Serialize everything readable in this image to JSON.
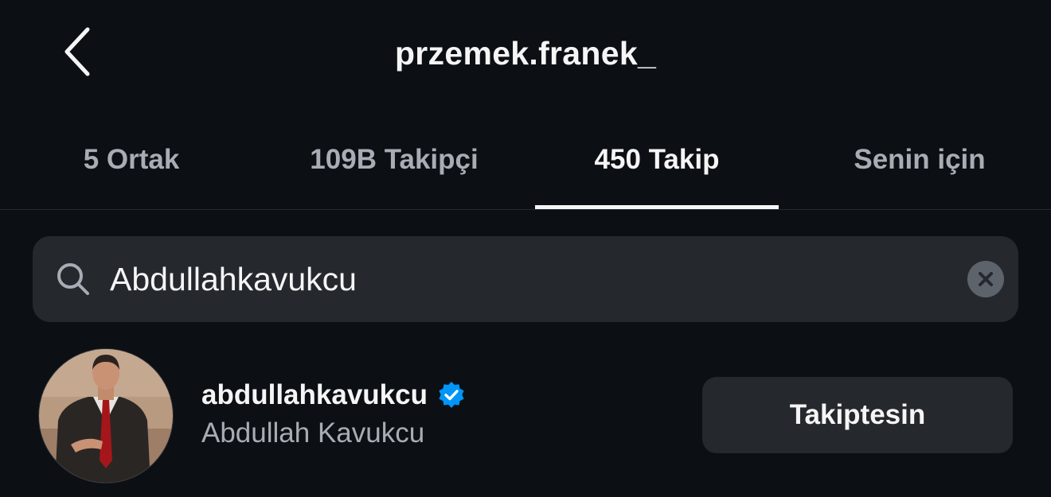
{
  "header": {
    "title": "przemek.franek_",
    "back_icon": "chevron-left-icon"
  },
  "tabs": [
    {
      "label": "5 Ortak",
      "active": false
    },
    {
      "label": "109B Takipçi",
      "active": false
    },
    {
      "label": "450 Takip",
      "active": true
    },
    {
      "label": "Senin için",
      "active": false
    }
  ],
  "search": {
    "value": "Abdullahkavukcu",
    "icon": "search-icon",
    "clear_icon": "clear-icon"
  },
  "results": [
    {
      "username": "abdullahkavukcu",
      "full_name": "Abdullah Kavukcu",
      "verified": true,
      "button_label": "Takiptesin"
    }
  ],
  "colors": {
    "background": "#0c1014",
    "surface": "#25292e",
    "text_primary": "#f5f5f5",
    "text_secondary": "#a8adb5",
    "verified_badge": "#0095f6"
  }
}
